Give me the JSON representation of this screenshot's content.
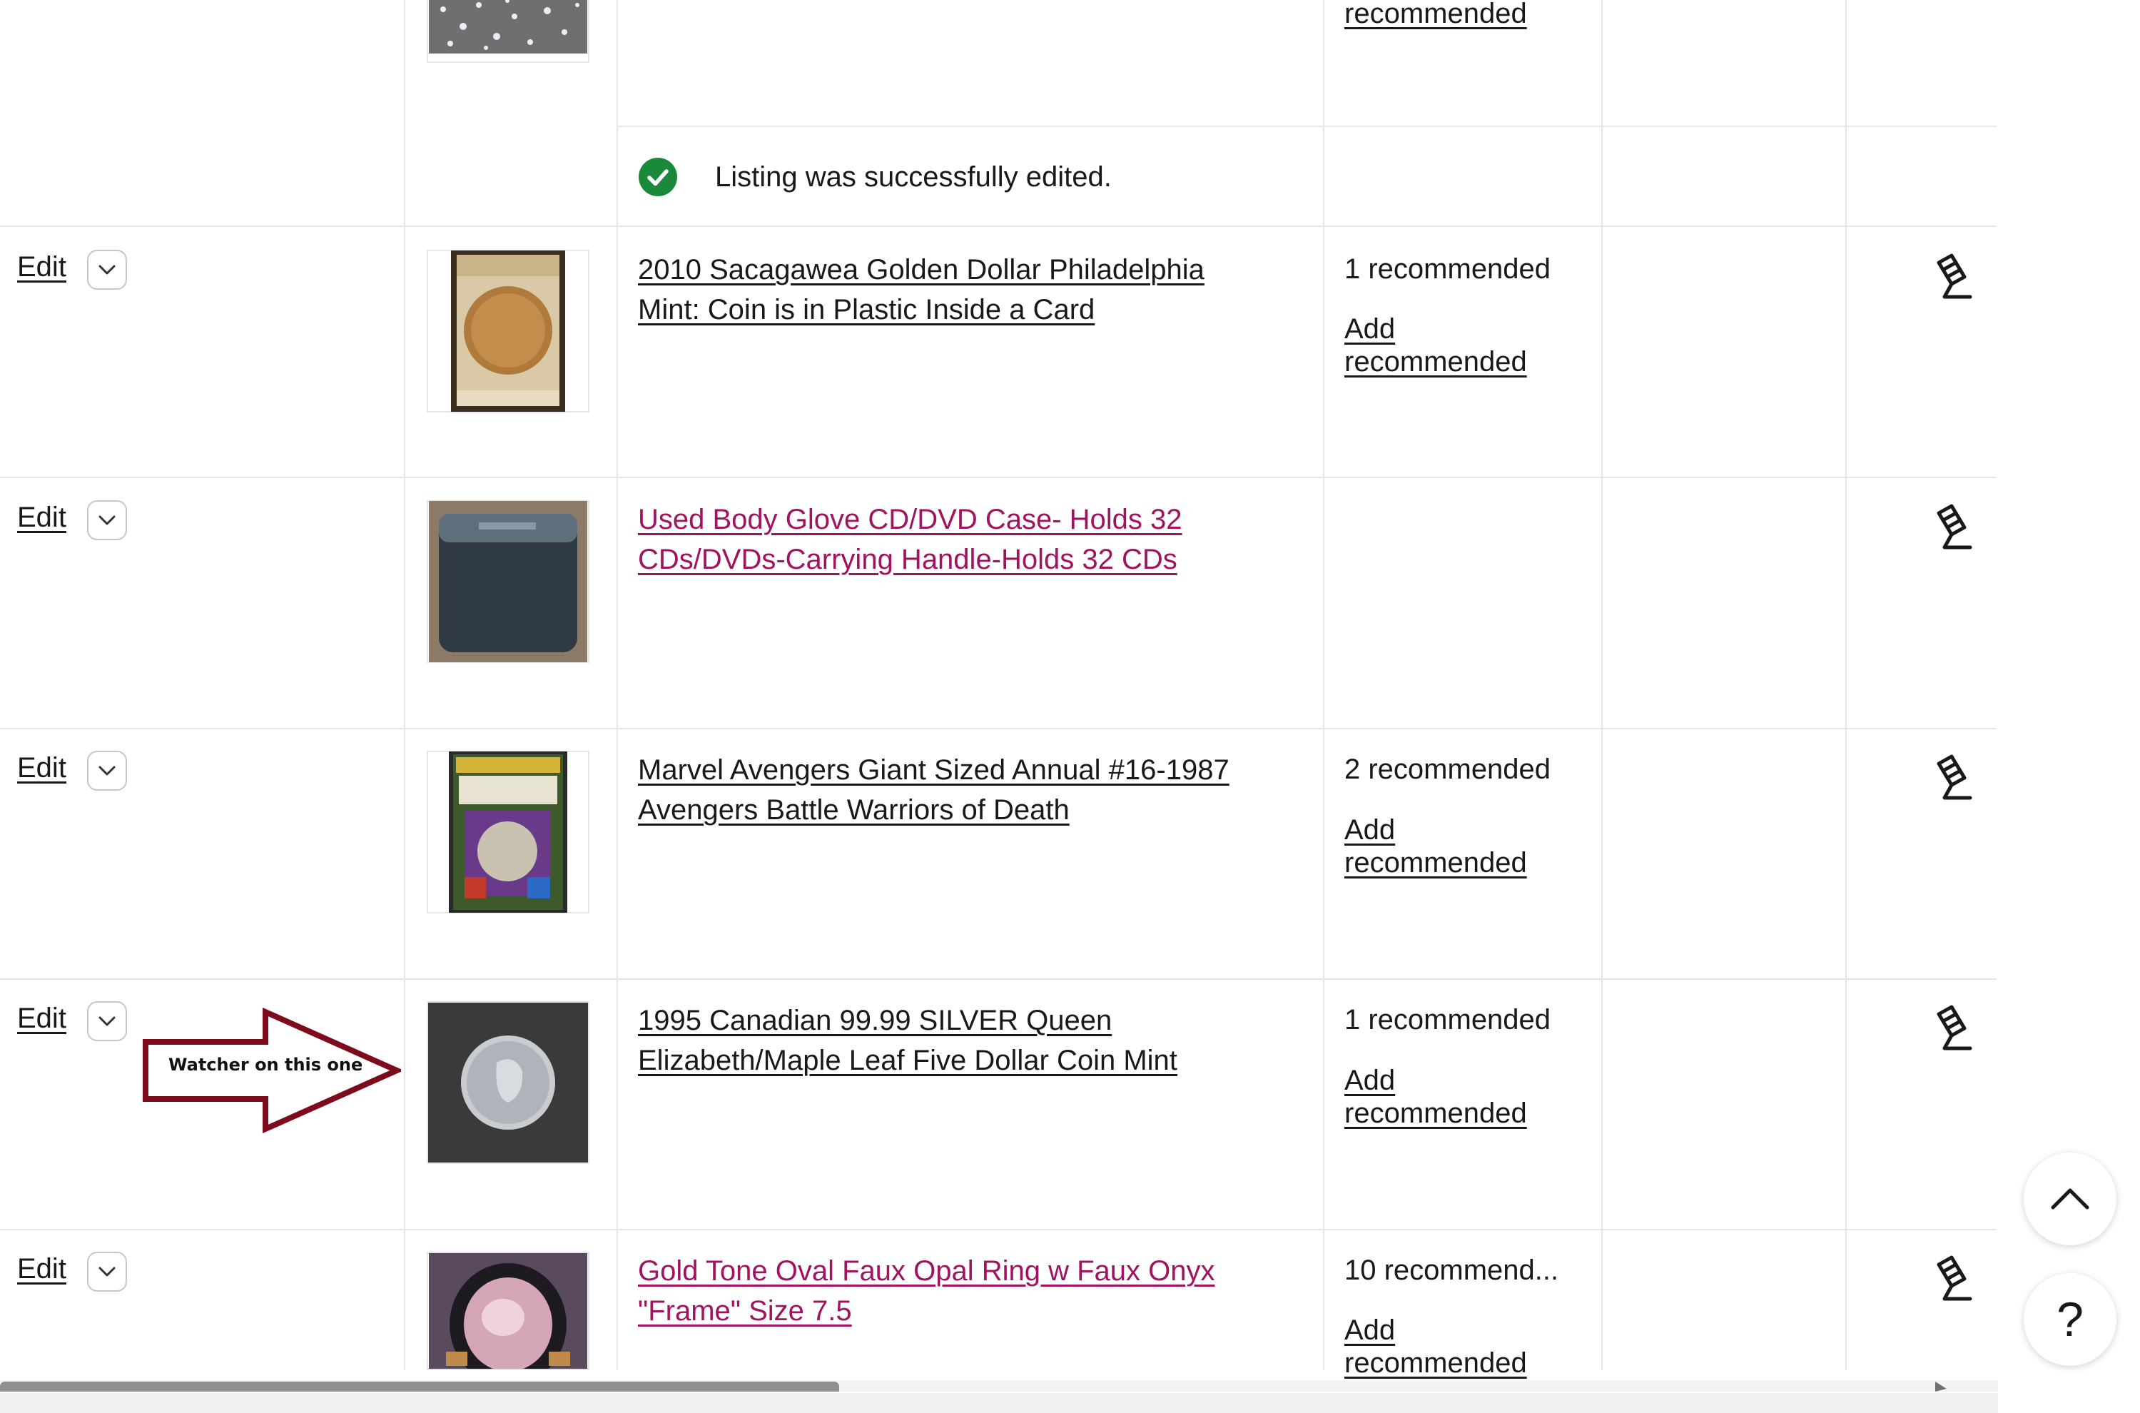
{
  "banner": {
    "message": "Listing was successfully edited."
  },
  "top_partial": {
    "add_recommended": "recommended"
  },
  "rows": [
    {
      "edit_label": "Edit",
      "title": "2010 Sacagawea Golden Dollar Philadelphia Mint: Coin is in Plastic Inside a Card",
      "visited": false,
      "recommended": "1 recommended",
      "add_recommended": "Add recommended"
    },
    {
      "edit_label": "Edit",
      "title": "Used Body Glove CD/DVD Case- Holds 32 CDs/DVDs-Carrying Handle-Holds 32 CDs",
      "visited": true,
      "recommended": "",
      "add_recommended": ""
    },
    {
      "edit_label": "Edit",
      "title": "Marvel Avengers Giant Sized Annual #16-1987 Avengers Battle Warriors of Death",
      "visited": false,
      "recommended": "2 recommended",
      "add_recommended": "Add recommended"
    },
    {
      "edit_label": "Edit",
      "title": "1995 Canadian 99.99 SILVER Queen Elizabeth/Maple Leaf Five Dollar Coin Mint",
      "visited": false,
      "recommended": "1 recommended",
      "add_recommended": "Add recommended"
    },
    {
      "edit_label": "Edit",
      "title": "Gold Tone Oval Faux Opal Ring w Faux Onyx \"Frame\" Size 7.5",
      "visited": true,
      "recommended": "10 recommend...",
      "add_recommended": "Add recommended"
    }
  ],
  "annotation": {
    "text": "Watcher on this one"
  },
  "colors": {
    "visited_link": "#a0135f",
    "success": "#1a8a3a",
    "annotation_arrow": "#7d0b1c",
    "scrollbar_thumb": "#8f8f8f"
  },
  "icons": {
    "gavel": "gavel-icon",
    "chevron": "chevron-down-icon",
    "back_to_top": "chevron-up-icon",
    "help": "help-icon"
  },
  "help_label": "?"
}
